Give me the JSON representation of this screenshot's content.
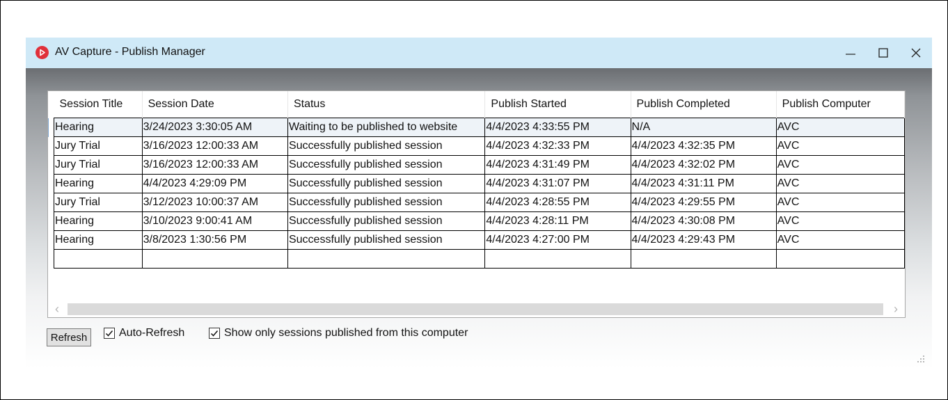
{
  "window": {
    "title": "AV Capture - Publish Manager",
    "icon": "play-circle-icon",
    "accent_color": "#e0303a",
    "titlebar_color": "#cfe9f7"
  },
  "grid": {
    "columns": [
      "Session Title",
      "Session Date",
      "Status",
      "Publish Started",
      "Publish Completed",
      "Publish Computer"
    ],
    "rows": [
      [
        "Hearing",
        "3/24/2023 3:30:05 AM",
        "Waiting to be published to website",
        "4/4/2023 4:33:55 PM",
        "N/A",
        "AVC"
      ],
      [
        "Jury Trial",
        "3/16/2023 12:00:33 AM",
        "Successfully published session",
        "4/4/2023 4:32:33 PM",
        "4/4/2023 4:32:35 PM",
        "AVC"
      ],
      [
        "Jury Trial",
        "3/16/2023 12:00:33 AM",
        "Successfully published session",
        "4/4/2023 4:31:49 PM",
        "4/4/2023 4:32:02 PM",
        "AVC"
      ],
      [
        "Hearing",
        "4/4/2023 4:29:09 PM",
        "Successfully published session",
        "4/4/2023 4:31:07 PM",
        "4/4/2023 4:31:11 PM",
        "AVC"
      ],
      [
        "Jury Trial",
        "3/12/2023 10:00:37 AM",
        "Successfully published session",
        "4/4/2023 4:28:55 PM",
        "4/4/2023 4:29:55 PM",
        "AVC"
      ],
      [
        "Hearing",
        "3/10/2023 9:00:41 AM",
        "Successfully published session",
        "4/4/2023 4:28:11 PM",
        "4/4/2023 4:30:08 PM",
        "AVC"
      ],
      [
        "Hearing",
        "3/8/2023 1:30:56 PM",
        "Successfully published session",
        "4/4/2023 4:27:00 PM",
        "4/4/2023 4:29:43 PM",
        "AVC"
      ],
      [
        "",
        "",
        "",
        "",
        "",
        ""
      ]
    ]
  },
  "footer": {
    "refresh_label": "Refresh",
    "auto_refresh_label": "Auto-Refresh",
    "auto_refresh_checked": true,
    "show_only_label": "Show only sessions published from this computer",
    "show_only_checked": true
  }
}
